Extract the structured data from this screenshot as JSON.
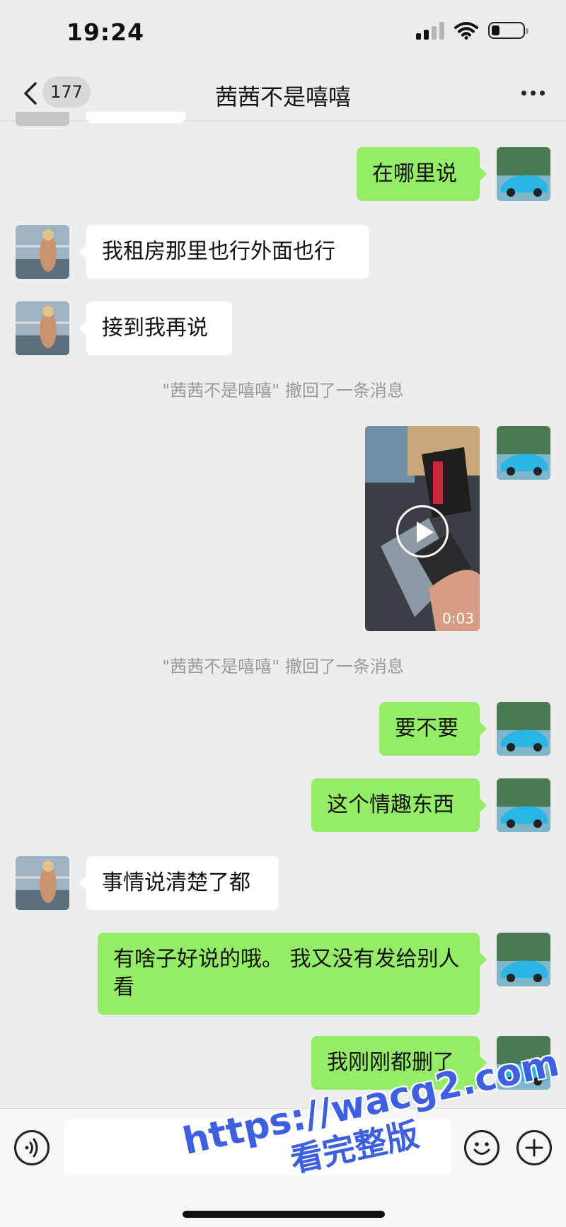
{
  "status_bar": {
    "time": "19:24",
    "battery_level": 0.25
  },
  "header": {
    "unread_count": "177",
    "title": "茜茜不是嘻嘻"
  },
  "messages": [
    {
      "side": "right",
      "text": "在哪里说"
    },
    {
      "side": "left",
      "text": "我租房那里也行外面也行"
    },
    {
      "side": "left",
      "text": "接到我再说"
    },
    {
      "type": "system",
      "text": "\"茜茜不是嘻嘻\" 撤回了一条消息"
    },
    {
      "side": "right",
      "type": "video",
      "duration": "0:03"
    },
    {
      "type": "system",
      "text": "\"茜茜不是嘻嘻\" 撤回了一条消息"
    },
    {
      "side": "right",
      "text": "要不要"
    },
    {
      "side": "right",
      "text": "这个情趣东西"
    },
    {
      "side": "left",
      "text": "事情说清楚了都"
    },
    {
      "side": "right",
      "text": "有啥子好说的哦。 我又没有发给别人看"
    },
    {
      "side": "right",
      "text": "我刚刚都删了"
    }
  ],
  "watermark": {
    "line1": "https://wacg2.com",
    "line2": "看完整版"
  },
  "colors": {
    "background": "#ededed",
    "sent_bubble": "#95ec69",
    "received_bubble": "#ffffff",
    "watermark": "#3d5fe0"
  },
  "icons": [
    "back-chevron-icon",
    "more-dots-icon",
    "voice-icon",
    "emoji-icon",
    "plus-icon",
    "play-icon"
  ]
}
